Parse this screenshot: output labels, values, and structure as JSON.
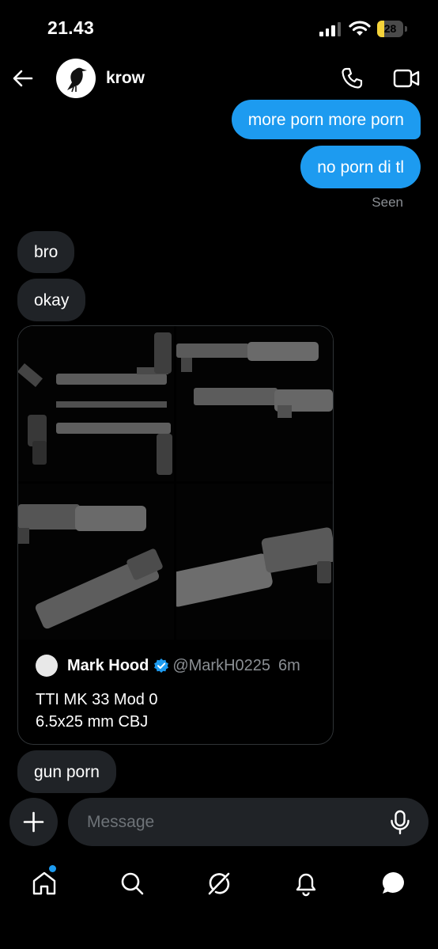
{
  "status_bar": {
    "time": "21.43",
    "battery": "28",
    "battery_level": 0.28
  },
  "header": {
    "contact_name": "krow"
  },
  "messages": {
    "out_1": "more porn more porn",
    "out_2": "no porn di tl",
    "seen": "Seen",
    "in_1": "bro",
    "in_2": "okay",
    "in_3": "gun porn"
  },
  "shared_post": {
    "author": "Mark Hood",
    "handle": "@MarkH0225",
    "age": "6m",
    "text_line1": "TTI MK 33 Mod 0",
    "text_line2": "6.5x25 mm CBJ"
  },
  "composer": {
    "placeholder": "Message"
  },
  "colors": {
    "accent": "#1d9bf0",
    "bubble_in": "#202327",
    "background": "#000000"
  },
  "icons": [
    "back-arrow-icon",
    "phone-icon",
    "video-icon",
    "plus-icon",
    "mic-icon",
    "home-icon",
    "search-icon",
    "grok-icon",
    "bell-icon",
    "messages-icon",
    "verified-icon"
  ]
}
